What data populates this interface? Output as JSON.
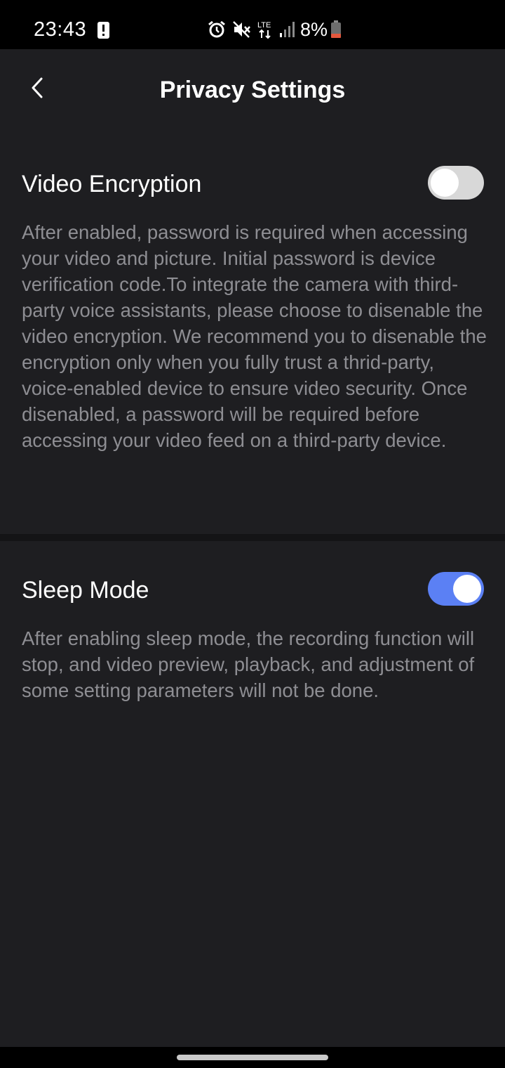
{
  "status_bar": {
    "time": "23:43",
    "battery_percent": "8%",
    "network_type": "LTE",
    "icons": [
      "alert-icon",
      "alarm-icon",
      "mute-icon",
      "lte-icon",
      "signal-icon",
      "battery-icon"
    ]
  },
  "header": {
    "title": "Privacy Settings",
    "back_icon": "chevron-left-icon"
  },
  "settings": [
    {
      "title": "Video Encryption",
      "enabled": false,
      "description": "After enabled, password is required when accessing your video and picture. Initial password is device verification code.To integrate the camera with third-party voice assistants, please choose to disenable the video encryption. We recommend you to disenable the encryption only when you fully trust a thrid-party, voice-enabled device to ensure video security. Once disenabled, a password will be required before accessing your video feed on a third-party device."
    },
    {
      "title": "Sleep Mode",
      "enabled": true,
      "description": "After enabling sleep mode, the recording function will stop, and video preview, playback, and adjustment of some setting parameters will not be done."
    }
  ],
  "colors": {
    "background": "#1e1e21",
    "toggle_on": "#5b80f4",
    "toggle_off": "#d8d8d8",
    "description_text": "#8e8e93"
  }
}
